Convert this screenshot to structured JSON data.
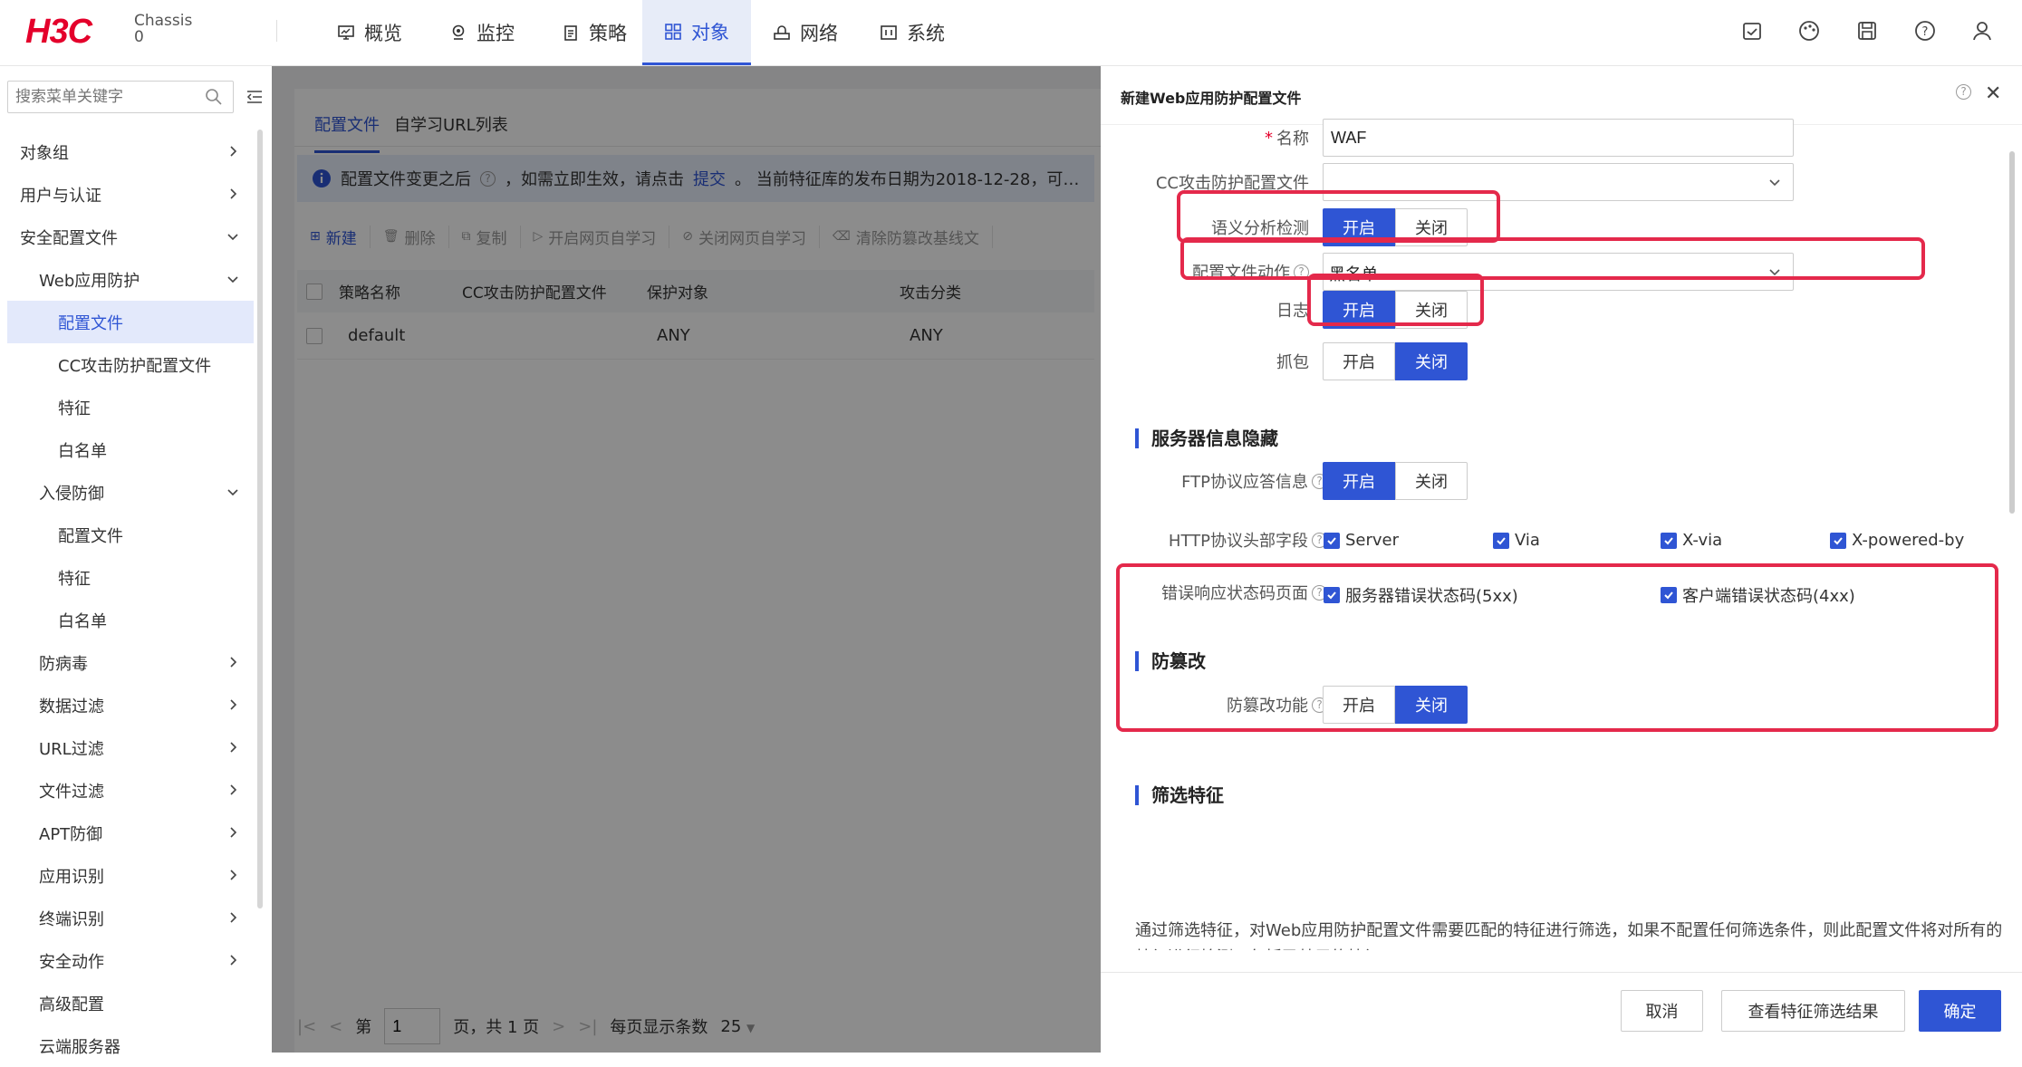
{
  "topbar": {
    "logo": "H3C",
    "chassis_line1": "Chassis",
    "chassis_line2": "0",
    "nav": [
      {
        "label": "概览",
        "icon": "monitor-icon"
      },
      {
        "label": "监控",
        "icon": "location-icon"
      },
      {
        "label": "策略",
        "icon": "clipboard-icon"
      },
      {
        "label": "对象",
        "icon": "grid-icon",
        "active": true
      },
      {
        "label": "网络",
        "icon": "network-icon"
      },
      {
        "label": "系统",
        "icon": "system-icon"
      }
    ],
    "right_icons": [
      "save-config-icon",
      "palette-icon",
      "disk-icon",
      "help-icon",
      "user-icon"
    ]
  },
  "sidebar": {
    "search_placeholder": "搜索菜单关键字",
    "items": [
      {
        "label": "对象组",
        "level": 1,
        "chevron": "right"
      },
      {
        "label": "用户与认证",
        "level": 1,
        "chevron": "right"
      },
      {
        "label": "安全配置文件",
        "level": 1,
        "chevron": "down"
      },
      {
        "label": "Web应用防护",
        "level": 2,
        "chevron": "down"
      },
      {
        "label": "配置文件",
        "level": 3,
        "active": true
      },
      {
        "label": "CC攻击防护配置文件",
        "level": 3
      },
      {
        "label": "特征",
        "level": 3
      },
      {
        "label": "白名单",
        "level": 3
      },
      {
        "label": "入侵防御",
        "level": 2,
        "chevron": "down"
      },
      {
        "label": "配置文件",
        "level": 3
      },
      {
        "label": "特征",
        "level": 3
      },
      {
        "label": "白名单",
        "level": 3
      },
      {
        "label": "防病毒",
        "level": 2,
        "chevron": "right"
      },
      {
        "label": "数据过滤",
        "level": 2,
        "chevron": "right"
      },
      {
        "label": "URL过滤",
        "level": 2,
        "chevron": "right"
      },
      {
        "label": "文件过滤",
        "level": 2,
        "chevron": "right"
      },
      {
        "label": "APT防御",
        "level": 2,
        "chevron": "right"
      },
      {
        "label": "应用识别",
        "level": 2,
        "chevron": "right"
      },
      {
        "label": "终端识别",
        "level": 2,
        "chevron": "right"
      },
      {
        "label": "安全动作",
        "level": 2,
        "chevron": "right"
      },
      {
        "label": "高级配置",
        "level": 2
      },
      {
        "label": "云端服务器",
        "level": 2
      }
    ]
  },
  "main": {
    "tabs": [
      {
        "label": "配置文件",
        "active": true
      },
      {
        "label": "自学习URL列表"
      }
    ],
    "notice": {
      "text1": "配置文件变更之后",
      "text2": "，如需立即生效，请点击",
      "link": "提交",
      "text3": "。  当前特征库的发布日期为2018-12-28，可…"
    },
    "toolbar": [
      {
        "label": "新建",
        "icon": "plus-icon",
        "enabled": true
      },
      {
        "label": "删除",
        "icon": "trash-icon"
      },
      {
        "label": "复制",
        "icon": "copy-icon"
      },
      {
        "label": "开启网页自学习",
        "icon": "play-icon"
      },
      {
        "label": "关闭网页自学习",
        "icon": "stop-icon"
      },
      {
        "label": "清除防篡改基线文",
        "icon": "clear-icon"
      }
    ],
    "columns": [
      "策略名称",
      "CC攻击防护配置文件",
      "保护对象",
      "攻击分类"
    ],
    "rows": [
      {
        "name": "default",
        "cc": "",
        "target": "ANY",
        "category": "ANY"
      }
    ],
    "pager": {
      "page_prefix": "第",
      "page": "1",
      "page_suffix": "页，共 1 页",
      "per_page_label": "每页显示条数",
      "per_page": "25"
    }
  },
  "drawer": {
    "title": "新建Web应用防护配置文件",
    "fields": {
      "name_label": "名称",
      "name_value": "WAF",
      "cc_label": "CC攻击防护配置文件",
      "cc_value": "",
      "semantic_label": "语义分析检测",
      "action_label": "配置文件动作",
      "action_value": "黑名单",
      "log_label": "日志",
      "capture_label": "抓包",
      "on": "开启",
      "off": "关闭"
    },
    "toggles": {
      "semantic": "开启",
      "log": "开启",
      "capture": "关闭",
      "ftp": "开启",
      "tamper": "关闭"
    },
    "server_hide": {
      "title": "服务器信息隐藏",
      "ftp_label": "FTP协议应答信息",
      "http_label": "HTTP协议头部字段",
      "http_options": [
        "Server",
        "Via",
        "X-via",
        "X-powered-by"
      ],
      "error_label": "错误响应状态码页面",
      "error_options": [
        "服务器错误状态码(5xx)",
        "客户端错误状态码(4xx)"
      ]
    },
    "tamper": {
      "title": "防篡改",
      "label": "防篡改功能"
    },
    "filter": {
      "title": "筛选特征",
      "desc": "通过筛选特征，对Web应用防护配置文件需要匹配的特征进行筛选，如果不配置任何筛选条件，则此配置文件将对所有的特征进行检测，包括已禁用的特征。"
    },
    "buttons": {
      "cancel": "取消",
      "view": "查看特征筛选结果",
      "ok": "确定"
    }
  },
  "colors": {
    "accent": "#2f55d4",
    "highlight": "#e4294b",
    "brand": "#e4002b"
  }
}
